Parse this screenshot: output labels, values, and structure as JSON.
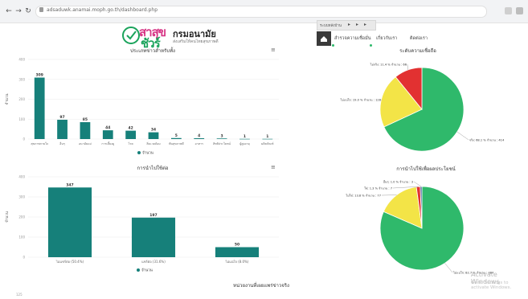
{
  "browser": {
    "url": "adsaduwk.anamai.moph.go.th/dashboard.php"
  },
  "header": {
    "logo_part1": "สาสุข",
    "logo_part2": "ชัวร์",
    "title": "กรมอนามัย",
    "subtitle": "ส่งเสริมให้คนไทยสุขภาพดี",
    "tab_label": "ระบบหลังบ้าน",
    "nav": [
      "สำรวจความเชื่อมั่น",
      "เกี่ยวกับเรา",
      "ติดต่อเรา"
    ]
  },
  "colors": {
    "bar": "#16807a",
    "green": "#2fb96b",
    "yellow": "#f3e447",
    "red": "#e23131"
  },
  "chart1": {
    "title": "ประเภทข่าวสำหรับทั้ง",
    "ylabel": "จำนวน",
    "legend": "จำนวน",
    "chart_data": {
      "type": "bar",
      "categories": [
        "สุขภาพกายใจ",
        "อื่นๆ",
        "อนามัยแม่",
        "การเลี้ยงดู",
        "โรค",
        "สิ่งแวดล้อม",
        "ฟันสุขภาพดี",
        "อาหาร",
        "สิทธิประโยชน์",
        "ผู้สูงอายุ",
        "ผลิตภัณฑ์"
      ],
      "values": [
        309,
        97,
        85,
        44,
        42,
        34,
        5,
        4,
        3,
        1,
        1
      ],
      "ylim": [
        0,
        400
      ],
      "yticks": [
        0,
        100,
        200,
        300,
        400
      ]
    }
  },
  "chart2": {
    "title": "ระดับความเชื่อถือ",
    "chart_data": {
      "type": "pie",
      "labels": [
        "จริง",
        "ไม่แน่ใจ",
        "ไม่จริง"
      ],
      "values": [
        414,
        128,
        66
      ],
      "percents": [
        68.1,
        19.0,
        11.4
      ],
      "slice_labels": [
        "จริง: 68.1 % จำนวน : 414",
        "ไม่แน่ใจ: 19.0 % จำนวน : 128",
        "ไม่จริง: 11.4 % จำนวน : 66"
      ]
    }
  },
  "chart3": {
    "title": "การนำไปใช้ต่อ",
    "ylabel": "จำนวน",
    "legend": "จำนวน",
    "chart_data": {
      "type": "bar",
      "categories": [
        "ไม่แชร์ต่อ (50.4%)",
        "แชร์ต่อ (31.6%)",
        "ไม่แน่ใจ (8.0%)"
      ],
      "values": [
        347,
        197,
        50
      ],
      "ylim": [
        0,
        400
      ],
      "yticks": [
        0,
        100,
        200,
        300,
        400
      ]
    }
  },
  "chart4": {
    "title": "การนำไปใช้เพื่อผลประโยชน์",
    "chart_data": {
      "type": "pie",
      "labels": [
        "ไม่แน่ใจ",
        "ไม่ใช่",
        "ใช่",
        "อื่นๆ"
      ],
      "values": [
        384,
        77,
        7,
        3
      ],
      "percents": [
        82.7,
        13.8,
        1.3,
        1.0
      ],
      "slice_labels": [
        "ไม่แน่ใจ: 82.7 % จำนวน : 384",
        "ไม่ใช่: 13.8 % จำนวน : 77",
        "ใช่: 1.3 % จำนวน : 7",
        "อื่นๆ: 1.0 % จำนวน : 3"
      ]
    }
  },
  "chart5": {
    "title": "หน่วยงานที่เผยแพร่ข่าวจริง"
  },
  "watermark": {
    "line1": "Activate Windows",
    "line2": "Go to Settings to activate Windows."
  }
}
